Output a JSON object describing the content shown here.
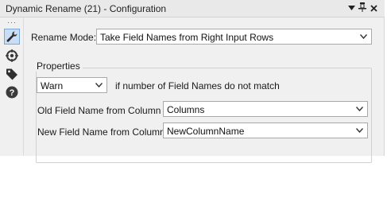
{
  "window": {
    "title": "Dynamic Rename (21) - Configuration",
    "buttons": {
      "dropdown": "▼",
      "pin": "📌",
      "close": "×"
    }
  },
  "toolstrip": {
    "dots": "···",
    "tools": [
      {
        "name": "configuration",
        "icon": "wrench-icon",
        "active": true
      },
      {
        "name": "annotation",
        "icon": "crosshair-icon",
        "active": false
      },
      {
        "name": "tag",
        "icon": "tag-icon",
        "active": false
      },
      {
        "name": "help",
        "icon": "question-icon",
        "active": false
      }
    ]
  },
  "config": {
    "rename_mode_label": "Rename Mode:",
    "rename_mode_value": "Take Field Names from Right Input Rows",
    "properties_title": "Properties",
    "warn_value": "Warn",
    "warn_suffix": "if number of Field Names do not match",
    "old_field_label": "Old Field Name from Column",
    "old_field_value": "Columns",
    "new_field_label": "New Field Name from Column",
    "new_field_value": "NewColumnName"
  },
  "colors": {
    "panel": "#f0f0f0",
    "active_tool": "#c9def5"
  }
}
